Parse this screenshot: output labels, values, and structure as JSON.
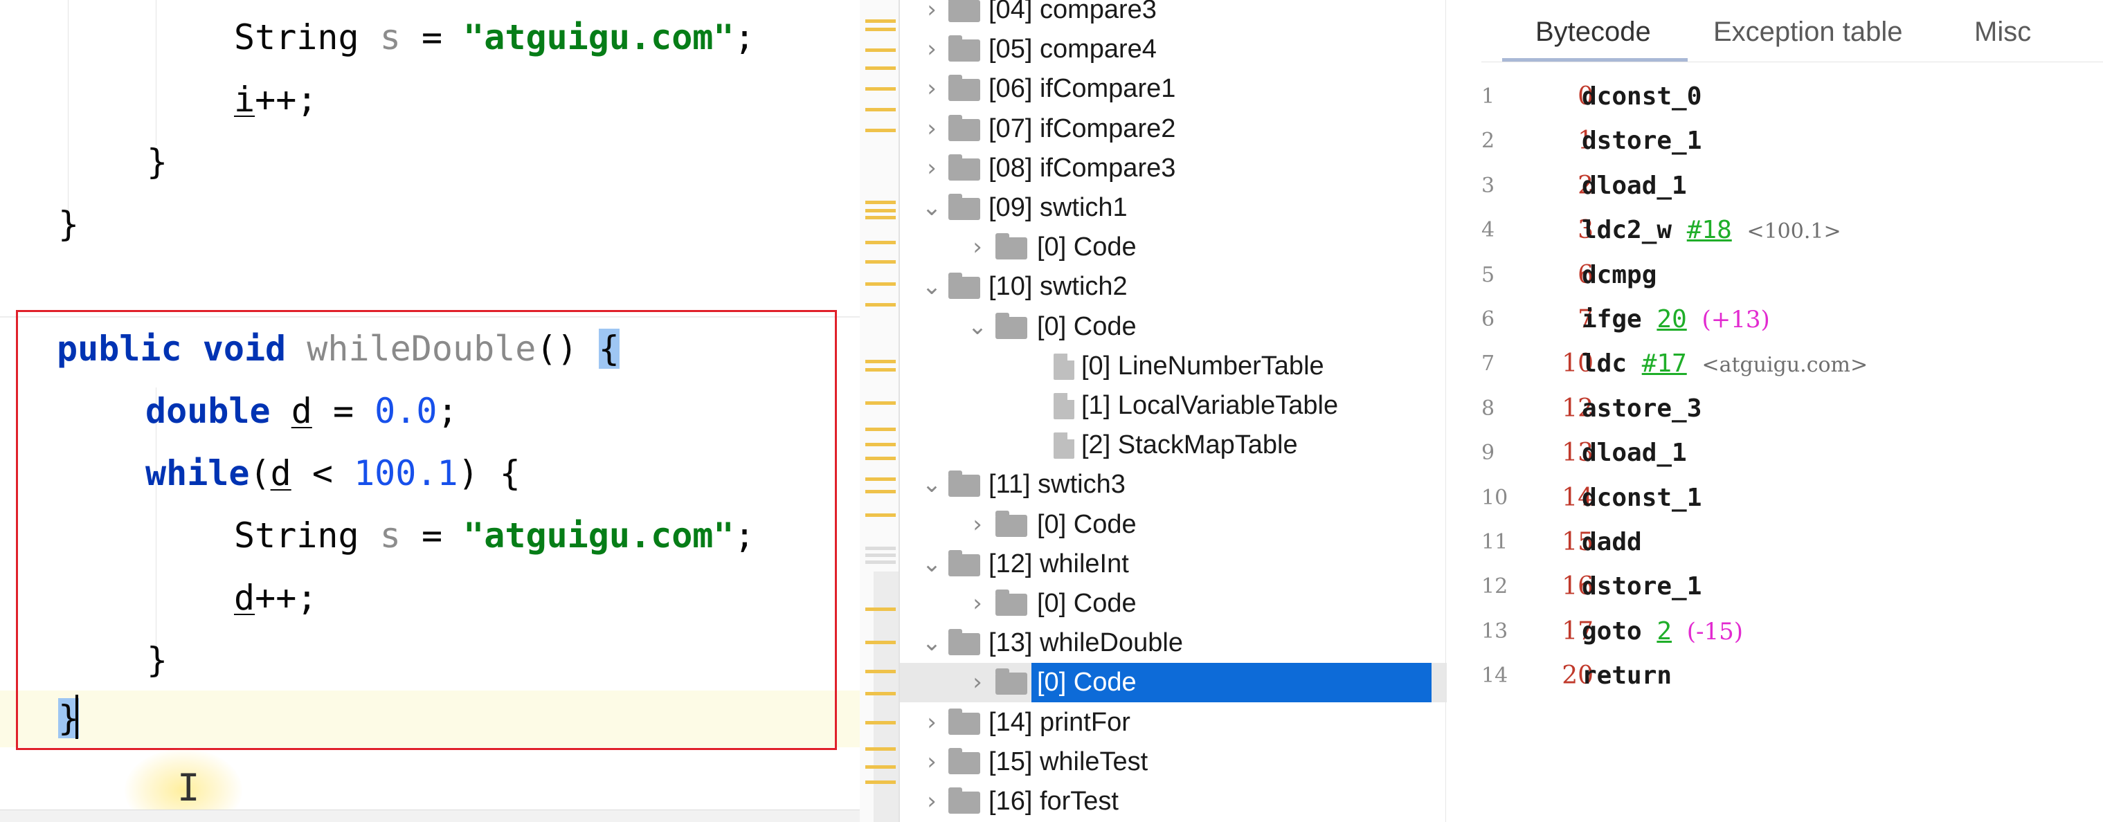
{
  "editor": {
    "top_fragment": {
      "line1": {
        "type": "String",
        "var": "s",
        "eq": "=",
        "str": "\"atguigu.com\"",
        "semi": ";"
      },
      "line2": {
        "var": "i",
        "rest": "++;"
      },
      "close_inner": "}",
      "close_outer": "}"
    },
    "method": {
      "kw_public": "public",
      "kw_void": "void",
      "name": "whileDouble",
      "parens": "()",
      "open_brace": "{",
      "decl": {
        "kw": "double",
        "var": "d",
        "eq": "=",
        "num": "0.0",
        "semi": ";"
      },
      "while": {
        "kw": "while",
        "open": "(",
        "var": "d",
        "op": "<",
        "num": "100.1",
        "close": ")",
        "brace": "{"
      },
      "body1": {
        "type": "String",
        "var": "s",
        "eq": "=",
        "str": "\"atguigu.com\"",
        "semi": ";"
      },
      "body2": {
        "var": "d",
        "rest": "++;"
      },
      "close_inner": "}",
      "close_outer": "}"
    },
    "cursor_glyph": "I"
  },
  "tree": {
    "items": [
      {
        "label": "[04] compare3",
        "chevron": "›",
        "level": 0
      },
      {
        "label": "[05] compare4",
        "chevron": "›",
        "level": 0
      },
      {
        "label": "[06] ifCompare1",
        "chevron": "›",
        "level": 0
      },
      {
        "label": "[07] ifCompare2",
        "chevron": "›",
        "level": 0
      },
      {
        "label": "[08] ifCompare3",
        "chevron": "›",
        "level": 0
      },
      {
        "label": "[09] swtich1",
        "chevron": "⌄",
        "level": 0
      },
      {
        "label": "[0] Code",
        "chevron": "›",
        "level": 1
      },
      {
        "label": "[10] swtich2",
        "chevron": "⌄",
        "level": 0
      },
      {
        "label": "[0] Code",
        "chevron": "⌄",
        "level": 1
      },
      {
        "label": "[0] LineNumberTable",
        "chevron": "",
        "level": 2
      },
      {
        "label": "[1] LocalVariableTable",
        "chevron": "",
        "level": 2
      },
      {
        "label": "[2] StackMapTable",
        "chevron": "",
        "level": 2
      },
      {
        "label": "[11] swtich3",
        "chevron": "⌄",
        "level": 0
      },
      {
        "label": "[0] Code",
        "chevron": "›",
        "level": 1
      },
      {
        "label": "[12] whileInt",
        "chevron": "⌄",
        "level": 0
      },
      {
        "label": "[0] Code",
        "chevron": "›",
        "level": 1
      },
      {
        "label": "[13] whileDouble",
        "chevron": "⌄",
        "level": 0
      },
      {
        "label": "[0] Code",
        "chevron": "›",
        "level": 1,
        "selected": true
      },
      {
        "label": "[14] printFor",
        "chevron": "›",
        "level": 0
      },
      {
        "label": "[15] whileTest",
        "chevron": "›",
        "level": 0
      },
      {
        "label": "[16] forTest",
        "chevron": "›",
        "level": 0
      }
    ]
  },
  "tabs": [
    {
      "label": "Bytecode",
      "active": true
    },
    {
      "label": "Exception table",
      "active": false
    },
    {
      "label": "Misc",
      "active": false
    }
  ],
  "bytecode": [
    {
      "line": "1",
      "offset": "0",
      "op": "dconst_0"
    },
    {
      "line": "2",
      "offset": "1",
      "op": "dstore_1"
    },
    {
      "line": "3",
      "offset": "2",
      "op": "dload_1"
    },
    {
      "line": "4",
      "offset": "3",
      "op": "ldc2_w",
      "ref": "#18",
      "comment": "<100.1>"
    },
    {
      "line": "5",
      "offset": "6",
      "op": "dcmpg"
    },
    {
      "line": "6",
      "offset": "7",
      "op": "ifge",
      "ref": "20",
      "jump": "(+13)"
    },
    {
      "line": "7",
      "offset": "10",
      "op": "ldc",
      "ref": "#17",
      "comment": "<atguigu.com>"
    },
    {
      "line": "8",
      "offset": "12",
      "op": "astore_3"
    },
    {
      "line": "9",
      "offset": "13",
      "op": "dload_1"
    },
    {
      "line": "10",
      "offset": "14",
      "op": "dconst_1"
    },
    {
      "line": "11",
      "offset": "15",
      "op": "dadd"
    },
    {
      "line": "12",
      "offset": "16",
      "op": "dstore_1"
    },
    {
      "line": "13",
      "offset": "17",
      "op": "goto",
      "ref": "2",
      "jump": "(-15)"
    },
    {
      "line": "14",
      "offset": "20",
      "op": "return"
    }
  ],
  "colors": {
    "keyword": "#0033b3",
    "string": "#067d17",
    "number": "#1750eb",
    "highlight_box": "#e0212b",
    "selection": "#0d6bd8",
    "marker": "#efc24a",
    "bc_offset": "#c0392b",
    "bc_ref": "#1fae29",
    "bc_jump": "#e22ad0"
  }
}
